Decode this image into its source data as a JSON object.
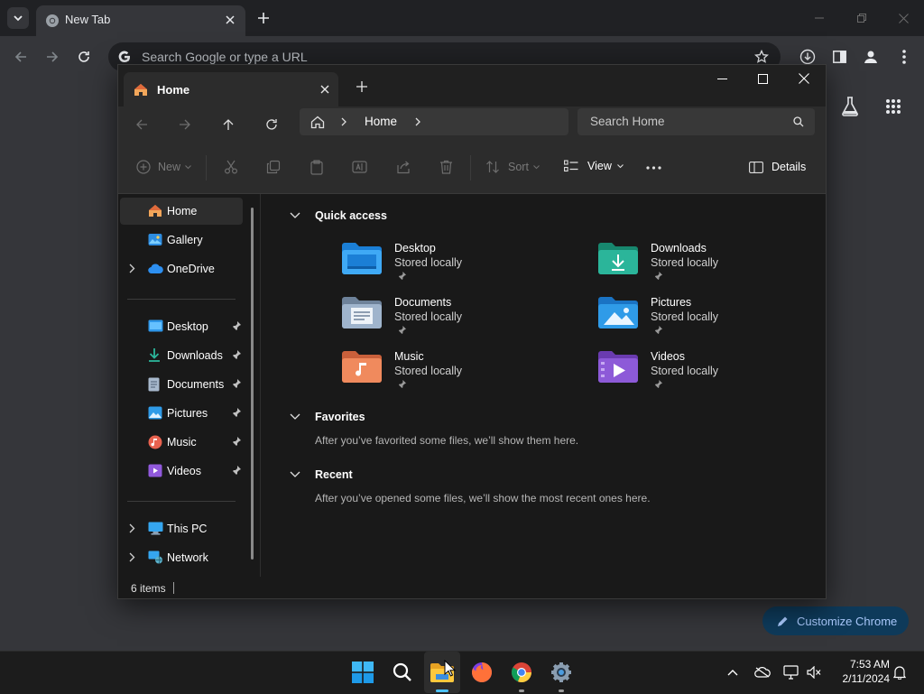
{
  "chrome": {
    "tab_title": "New Tab",
    "omnibox_placeholder": "Search Google or type a URL",
    "customize_label": "Customize Chrome"
  },
  "explorer": {
    "tab_title": "Home",
    "breadcrumb": "Home",
    "search_placeholder": "Search Home",
    "toolbar": {
      "new_label": "New",
      "sort_label": "Sort",
      "view_label": "View",
      "details_label": "Details"
    },
    "nav": {
      "top": [
        {
          "label": "Home",
          "icon": "home-icon",
          "selected": true
        },
        {
          "label": "Gallery",
          "icon": "gallery-icon"
        },
        {
          "label": "OneDrive",
          "icon": "onedrive-icon",
          "expandable": true
        }
      ],
      "pinned": [
        {
          "label": "Desktop",
          "icon": "desktop-folder-icon"
        },
        {
          "label": "Downloads",
          "icon": "downloads-folder-icon"
        },
        {
          "label": "Documents",
          "icon": "documents-folder-icon"
        },
        {
          "label": "Pictures",
          "icon": "pictures-folder-icon"
        },
        {
          "label": "Music",
          "icon": "music-folder-icon"
        },
        {
          "label": "Videos",
          "icon": "videos-folder-icon"
        }
      ],
      "bottom": [
        {
          "label": "This PC",
          "icon": "this-pc-icon"
        },
        {
          "label": "Network",
          "icon": "network-icon"
        }
      ]
    },
    "quick_access": {
      "title": "Quick access",
      "items": [
        {
          "name": "Desktop",
          "status": "Stored locally",
          "color": "#3fa9f5"
        },
        {
          "name": "Downloads",
          "status": "Stored locally",
          "color": "#2bb59a"
        },
        {
          "name": "Documents",
          "status": "Stored locally",
          "color": "#9fb4cc"
        },
        {
          "name": "Pictures",
          "status": "Stored locally",
          "color": "#2f9be8"
        },
        {
          "name": "Music",
          "status": "Stored locally",
          "color": "#f08a5d"
        },
        {
          "name": "Videos",
          "status": "Stored locally",
          "color": "#8d5ad8"
        }
      ]
    },
    "favorites": {
      "title": "Favorites",
      "hint": "After you’ve favorited some files, we’ll show them here."
    },
    "recent": {
      "title": "Recent",
      "hint": "After you’ve opened some files, we’ll show the most recent ones here."
    },
    "status": "6 items"
  },
  "taskbar": {
    "time": "7:53 AM",
    "date": "2/11/2024",
    "apps": [
      "start-icon",
      "search-icon",
      "file-explorer-icon",
      "firefox-icon",
      "chrome-icon",
      "settings-icon"
    ]
  }
}
